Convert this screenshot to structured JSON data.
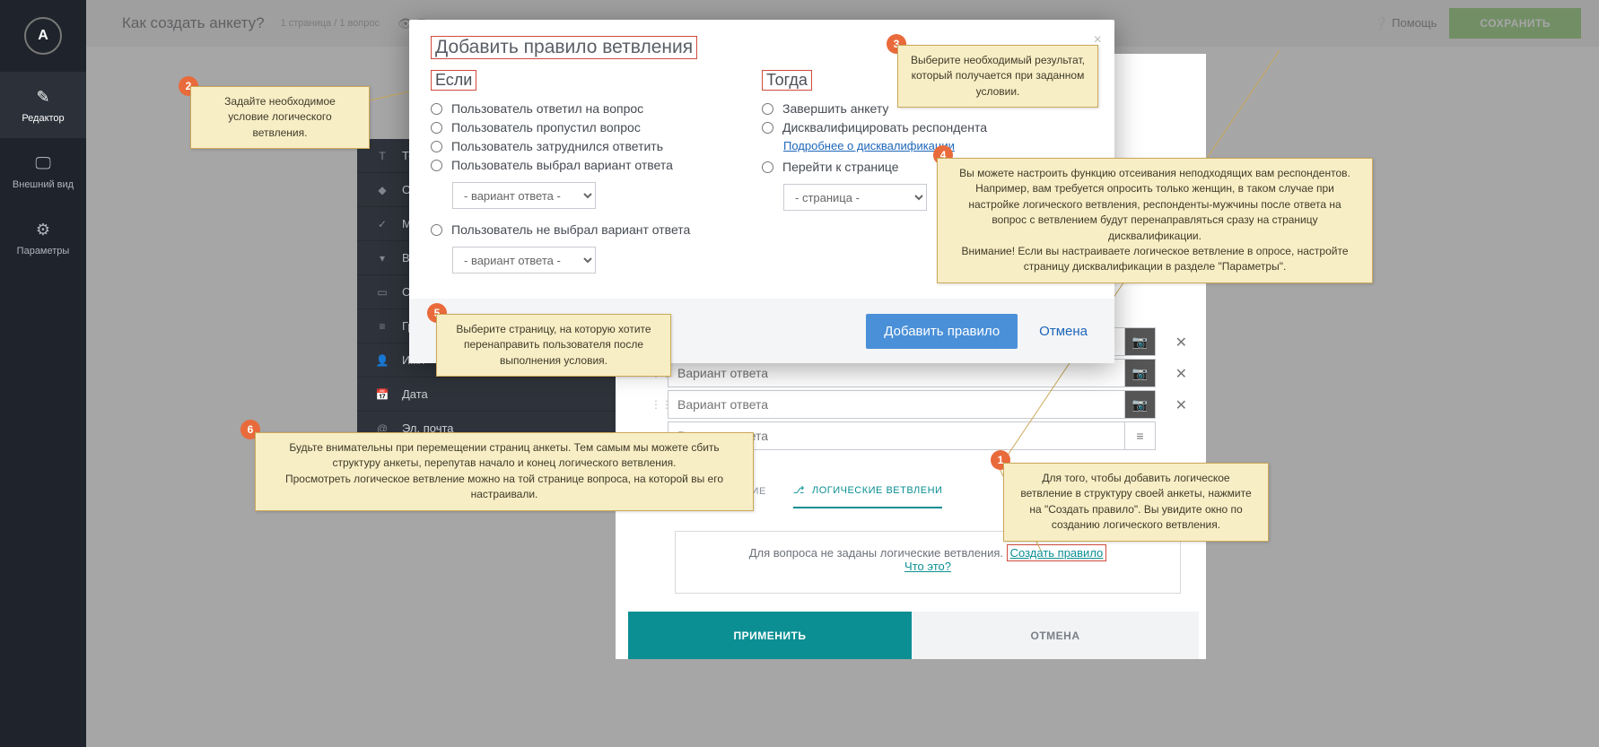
{
  "sidebar": {
    "logo": "A",
    "items": [
      {
        "label": "Редактор"
      },
      {
        "label": "Внешний вид"
      },
      {
        "label": "Параметры"
      }
    ]
  },
  "topbar": {
    "title": "Как создать анкету?",
    "meta": "1 страница / 1 вопрос",
    "preview": "Посмотреть",
    "help": "Помощь",
    "save": "СОХРАНИТЬ"
  },
  "qtypes": [
    "Те",
    "Од",
    "М",
    "Вы",
    "Св",
    "Группа",
    "Имя",
    "Дата",
    "Эл. почта"
  ],
  "answers": {
    "placeholder": "Вариант ответа"
  },
  "tabs": {
    "display": "ОТОБРАЖЕНИЕ",
    "branch": "ЛОГИЧЕСКИЕ ВЕТВЛЕНИ"
  },
  "logic_box": {
    "text": "Для вопроса не заданы логические ветвления. ",
    "create": "Создать правило",
    "what": "Что это?"
  },
  "footer": {
    "apply": "ПРИМЕНИТЬ",
    "cancel": "ОТМЕНА"
  },
  "modal": {
    "title": "Добавить правило ветвления",
    "if_title": "Если",
    "then_title": "Тогда",
    "if_opts": [
      "Пользователь ответил на вопрос",
      "Пользователь пропустил вопрос",
      "Пользователь затруднился ответить",
      "Пользователь выбрал вариант ответа",
      "Пользователь не выбрал вариант ответа"
    ],
    "variant_sel": "- вариант ответа -",
    "then_opts": [
      "Завершить анкету",
      "Дисквалифицировать респондента",
      "Перейти к странице"
    ],
    "disq_link": "Подробнее о дисквалификации",
    "page_sel": "- страница -",
    "add_btn": "Добавить правило",
    "cancel_btn": "Отмена"
  },
  "tips": {
    "t1": "Для того, чтобы добавить логическое ветвление в структуру своей анкеты, нажмите на \"Создать правило\". Вы увидите окно по созданию логического ветвления.",
    "t2": "Задайте необходимое условие логического ветвления.",
    "t3": "Выберите необходимый результат, который получается при заданном условии.",
    "t4": "Вы можете настроить функцию отсеивания неподходящих вам респондентов. Например, вам требуется опросить только женщин, в таком случае при настройке логического ветвления, респонденты-мужчины после ответа на вопрос с ветвлением будут перенаправляться сразу на страницу дисквалификации.\nВнимание! Если вы настраиваете логическое ветвление в опросе, настройте страницу дисквалификации в разделе \"Параметры\".",
    "t5": "Выберите страницу, на которую хотите перенаправить пользователя после выполнения условия.",
    "t6": "Будьте внимательны при перемещении страниц анкеты. Тем самым мы можете сбить структуру анкеты, перепутав начало и конец логического ветвления.\nПросмотреть логическое ветвление можно на той странице вопроса, на которой вы его настраивали."
  }
}
